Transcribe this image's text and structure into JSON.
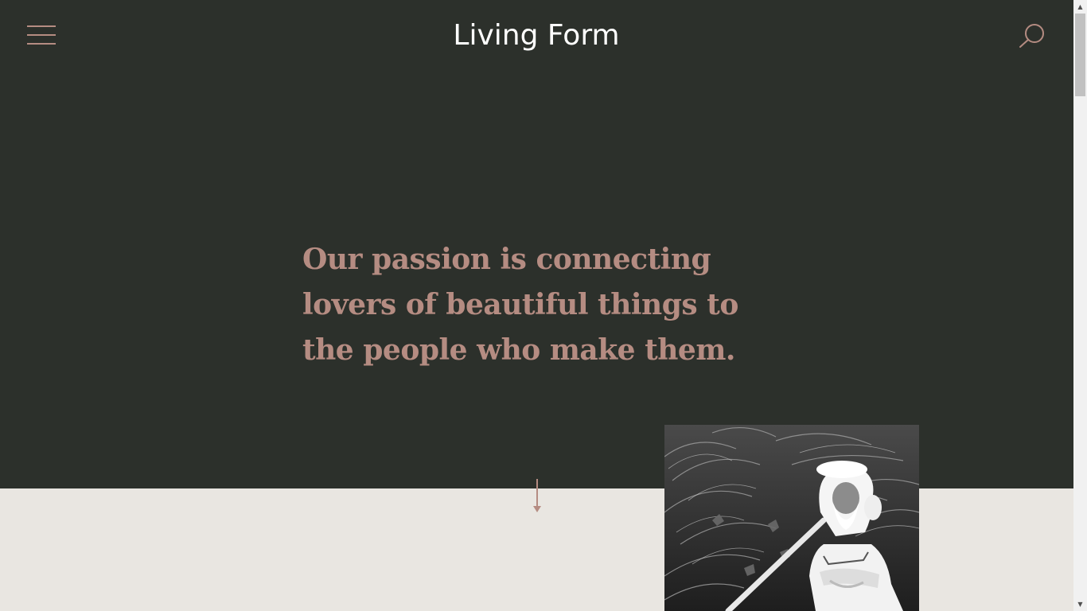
{
  "header": {
    "brand": "Living Form",
    "menu_icon": "hamburger-menu-icon",
    "search_icon": "search-icon"
  },
  "hero": {
    "headline": "Our passion is connecting lovers of beautiful things to the people who make them.",
    "scroll_icon": "arrow-down-icon"
  },
  "feature_image": {
    "subject": "black-and-white photo of elderly bearded man in white robes and head wrap seated among tall grass"
  },
  "colors": {
    "hero_background": "#2c302b",
    "lower_background": "#e9e6e1",
    "accent": "#b58c82",
    "brand_text": "#ffffff"
  },
  "scrollbar": {
    "up_arrow": "▲",
    "down_arrow": "▼"
  }
}
